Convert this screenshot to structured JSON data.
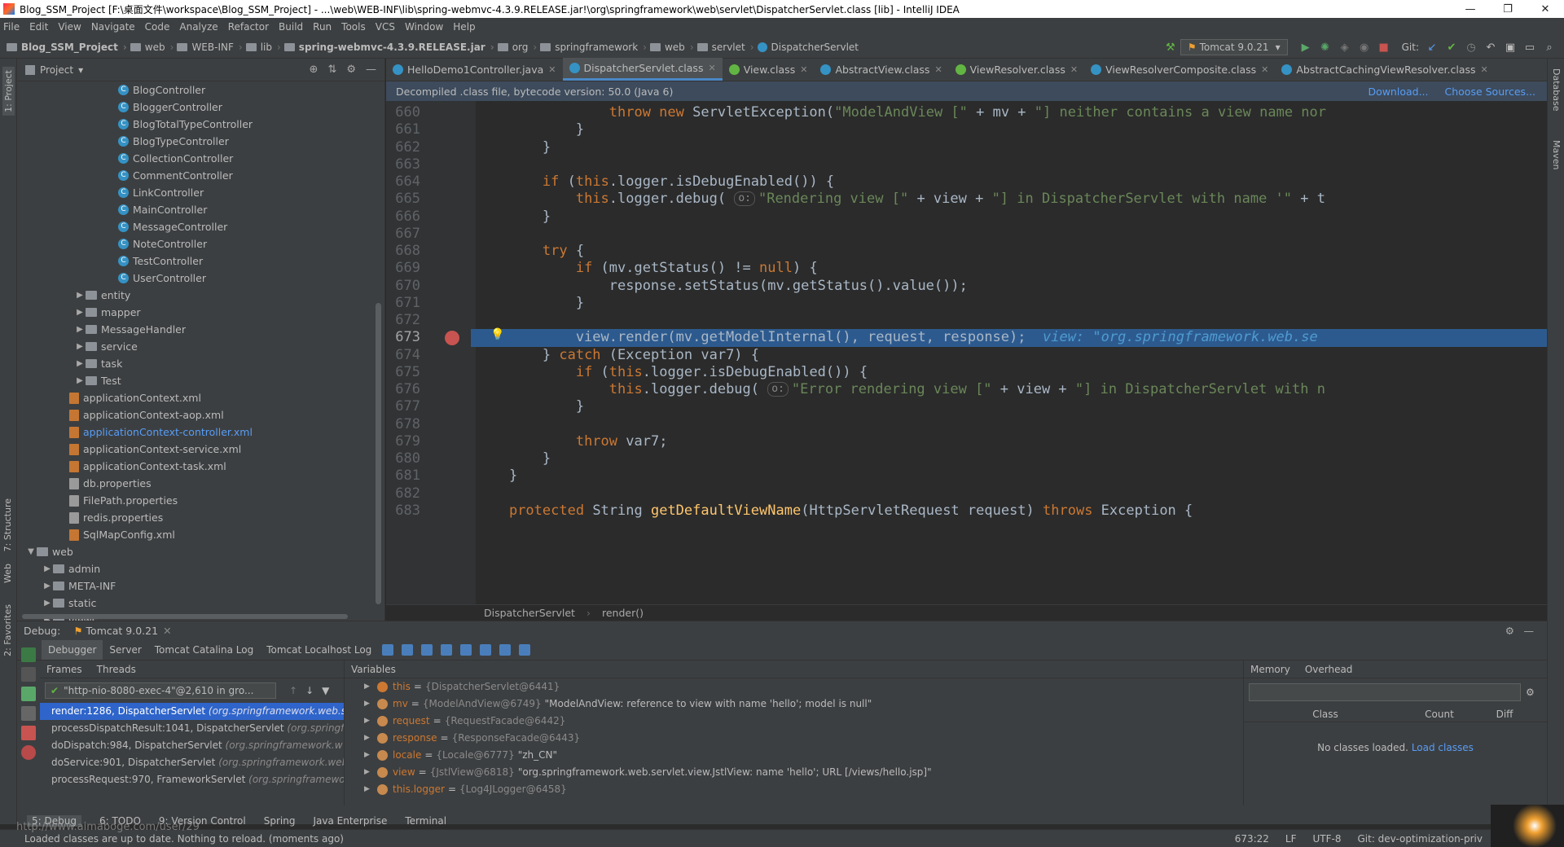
{
  "window": {
    "title": "Blog_SSM_Project [F:\\桌面文件\\workspace\\Blog_SSM_Project] - ...\\web\\WEB-INF\\lib\\spring-webmvc-4.3.9.RELEASE.jar!\\org\\springframework\\web\\servlet\\DispatcherServlet.class [lib] - IntelliJ IDEA",
    "min": "—",
    "max": "❐",
    "close": "✕"
  },
  "menu": [
    "File",
    "Edit",
    "View",
    "Navigate",
    "Code",
    "Analyze",
    "Refactor",
    "Build",
    "Run",
    "Tools",
    "VCS",
    "Window",
    "Help"
  ],
  "breadcrumbs": [
    "Blog_SSM_Project",
    "web",
    "WEB-INF",
    "lib",
    "spring-webmvc-4.3.9.RELEASE.jar",
    "org",
    "springframework",
    "web",
    "servlet",
    "DispatcherServlet"
  ],
  "run_config": "Tomcat 9.0.21",
  "git_label": "Git:",
  "project_panel": {
    "title": "Project",
    "tree": [
      {
        "label": "BlogController",
        "type": "class",
        "indent": 6
      },
      {
        "label": "BloggerController",
        "type": "class",
        "indent": 6
      },
      {
        "label": "BlogTotalTypeController",
        "type": "class",
        "indent": 6
      },
      {
        "label": "BlogTypeController",
        "type": "class",
        "indent": 6
      },
      {
        "label": "CollectionController",
        "type": "class",
        "indent": 6
      },
      {
        "label": "CommentController",
        "type": "class",
        "indent": 6
      },
      {
        "label": "LinkController",
        "type": "class",
        "indent": 6
      },
      {
        "label": "MainController",
        "type": "class",
        "indent": 6
      },
      {
        "label": "MessageController",
        "type": "class",
        "indent": 6
      },
      {
        "label": "NoteController",
        "type": "class",
        "indent": 6
      },
      {
        "label": "TestController",
        "type": "class",
        "indent": 6
      },
      {
        "label": "UserController",
        "type": "class",
        "indent": 6
      },
      {
        "label": "entity",
        "type": "folder",
        "indent": 4,
        "arrow": "▶"
      },
      {
        "label": "mapper",
        "type": "folder",
        "indent": 4,
        "arrow": "▶"
      },
      {
        "label": "MessageHandler",
        "type": "folder",
        "indent": 4,
        "arrow": "▶"
      },
      {
        "label": "service",
        "type": "folder",
        "indent": 4,
        "arrow": "▶"
      },
      {
        "label": "task",
        "type": "folder",
        "indent": 4,
        "arrow": "▶"
      },
      {
        "label": "Test",
        "type": "folder",
        "indent": 4,
        "arrow": "▶"
      },
      {
        "label": "applicationContext.xml",
        "type": "xml",
        "indent": 3
      },
      {
        "label": "applicationContext-aop.xml",
        "type": "xml",
        "indent": 3
      },
      {
        "label": "applicationContext-controller.xml",
        "type": "xml",
        "indent": 3,
        "blue": true
      },
      {
        "label": "applicationContext-service.xml",
        "type": "xml",
        "indent": 3
      },
      {
        "label": "applicationContext-task.xml",
        "type": "xml",
        "indent": 3
      },
      {
        "label": "db.properties",
        "type": "prop",
        "indent": 3
      },
      {
        "label": "FilePath.properties",
        "type": "prop",
        "indent": 3
      },
      {
        "label": "redis.properties",
        "type": "prop",
        "indent": 3
      },
      {
        "label": "SqlMapConfig.xml",
        "type": "xml",
        "indent": 3
      },
      {
        "label": "web",
        "type": "folder",
        "indent": 1,
        "arrow": "▼"
      },
      {
        "label": "admin",
        "type": "folder",
        "indent": 2,
        "arrow": "▶"
      },
      {
        "label": "META-INF",
        "type": "folder",
        "indent": 2,
        "arrow": "▶"
      },
      {
        "label": "static",
        "type": "folder",
        "indent": 2,
        "arrow": "▶"
      },
      {
        "label": "views",
        "type": "folder",
        "indent": 2,
        "arrow": "▶"
      }
    ]
  },
  "editor": {
    "tabs": [
      {
        "label": "HelloDemo1Controller.java",
        "icon": "class"
      },
      {
        "label": "DispatcherServlet.class",
        "icon": "class",
        "active": true
      },
      {
        "label": "View.class",
        "icon": "interface"
      },
      {
        "label": "AbstractView.class",
        "icon": "class"
      },
      {
        "label": "ViewResolver.class",
        "icon": "interface"
      },
      {
        "label": "ViewResolverComposite.class",
        "icon": "class"
      },
      {
        "label": "AbstractCachingViewResolver.class",
        "icon": "class"
      }
    ],
    "banner": "Decompiled .class file, bytecode version: 50.0 (Java 6)",
    "banner_links": [
      "Download...",
      "Choose Sources..."
    ],
    "lines": [
      {
        "n": "660",
        "html": "                <span class=\"kw\">throw new</span> ServletException(<span class=\"str\">\"ModelAndView [\"</span> + mv + <span class=\"str\">\"] neither contains a view name nor</span>"
      },
      {
        "n": "661",
        "html": "            }"
      },
      {
        "n": "662",
        "html": "        }"
      },
      {
        "n": "663",
        "html": ""
      },
      {
        "n": "664",
        "html": "        <span class=\"kw\">if</span> (<span class=\"kw\">this</span>.logger.isDebugEnabled()) {"
      },
      {
        "n": "665",
        "html": "            <span class=\"kw\">this</span>.logger.debug( <span class=\"pill\">o:</span><span class=\"str\">\"Rendering view [\"</span> + view + <span class=\"str\">\"] in DispatcherServlet with name '\"</span> + t"
      },
      {
        "n": "666",
        "html": "        }"
      },
      {
        "n": "667",
        "html": ""
      },
      {
        "n": "668",
        "html": "        <span class=\"kw\">try</span> {"
      },
      {
        "n": "669",
        "html": "            <span class=\"kw\">if</span> (mv.getStatus() != <span class=\"kw\">null</span>) {"
      },
      {
        "n": "670",
        "html": "                response.setStatus(mv.getStatus().value());"
      },
      {
        "n": "671",
        "html": "            }"
      },
      {
        "n": "672",
        "html": ""
      },
      {
        "n": "673",
        "html": "            view.render(mv.getModelInternal(), request, response);  <span class=\"inl\">view: \"org.springframework.web.se</span>",
        "hl": true
      },
      {
        "n": "674",
        "html": "        } <span class=\"kw\">catch</span> (Exception var7) {"
      },
      {
        "n": "675",
        "html": "            <span class=\"kw\">if</span> (<span class=\"kw\">this</span>.logger.isDebugEnabled()) {"
      },
      {
        "n": "676",
        "html": "                <span class=\"kw\">this</span>.logger.debug( <span class=\"pill\">o:</span><span class=\"str\">\"Error rendering view [\"</span> + view + <span class=\"str\">\"] in DispatcherServlet with n</span>"
      },
      {
        "n": "677",
        "html": "            }"
      },
      {
        "n": "678",
        "html": ""
      },
      {
        "n": "679",
        "html": "            <span class=\"kw\">throw</span> var7;"
      },
      {
        "n": "680",
        "html": "        }"
      },
      {
        "n": "681",
        "html": "    }"
      },
      {
        "n": "682",
        "html": ""
      },
      {
        "n": "683",
        "html": "    <span class=\"kw\">protected</span> String <span class=\"fn\">getDefaultViewName</span>(HttpServletRequest request) <span class=\"kw\">throws</span> Exception {"
      }
    ],
    "breadcrumb": [
      "DispatcherServlet",
      "render()"
    ]
  },
  "debug": {
    "label": "Debug:",
    "session": "Tomcat 9.0.21",
    "tabs": [
      "Debugger",
      "Server",
      "Tomcat Catalina Log",
      "Tomcat Localhost Log"
    ],
    "frames_label": "Frames",
    "threads_label": "Threads",
    "thread_selected": "\"http-nio-8080-exec-4\"@2,610 in gro...",
    "frames": [
      {
        "method": "render:1286, DispatcherServlet",
        "pkg": "(org.springframework.web.se"
      },
      {
        "method": "processDispatchResult:1041, DispatcherServlet",
        "pkg": "(org.springfra"
      },
      {
        "method": "doDispatch:984, DispatcherServlet",
        "pkg": "(org.springframework.w"
      },
      {
        "method": "doService:901, DispatcherServlet",
        "pkg": "(org.springframework.web."
      },
      {
        "method": "processRequest:970, FrameworkServlet",
        "pkg": "(org.springframework"
      }
    ],
    "variables_label": "Variables",
    "variables": [
      {
        "name": "this",
        "type": "{DispatcherServlet@6441}",
        "value": "",
        "arrow": "▶"
      },
      {
        "name": "mv",
        "type": "{ModelAndView@6749}",
        "value": "\"ModelAndView: reference to view with name 'hello'; model is null\"",
        "arrow": "▶"
      },
      {
        "name": "request",
        "type": "{RequestFacade@6442}",
        "value": "",
        "arrow": "▶"
      },
      {
        "name": "response",
        "type": "{ResponseFacade@6443}",
        "value": "",
        "arrow": "▶"
      },
      {
        "name": "locale",
        "type": "{Locale@6777}",
        "value": "\"zh_CN\"",
        "arrow": "▶"
      },
      {
        "name": "view",
        "type": "{JstlView@6818}",
        "value": "\"org.springframework.web.servlet.view.JstlView: name 'hello'; URL [/views/hello.jsp]\"",
        "arrow": "▶"
      },
      {
        "name": "this.logger",
        "type": "{Log4JLogger@6458}",
        "value": "",
        "arrow": "▶"
      }
    ],
    "memory_label": "Memory",
    "overhead_label": "Overhead",
    "mem_cols": [
      "Class",
      "Count",
      "Diff"
    ],
    "no_classes": "No classes loaded.",
    "load_classes": "Load classes"
  },
  "bottom_tabs": [
    "5: Debug",
    "6: TODO",
    "9: Version Control",
    "Spring",
    "Java Enterprise",
    "Terminal"
  ],
  "status": {
    "message": "Loaded classes are up to date. Nothing to reload. (moments ago)",
    "position": "673:22",
    "line_sep": "LF",
    "encoding": "UTF-8",
    "git_branch": "Git: dev-optimization-priv"
  },
  "watermark": "http://www.aimaboge.com/user/29",
  "stripe": {
    "project": "1: Project",
    "structure": "7: Structure",
    "web": "Web",
    "favorites": "2: Favorites",
    "database": "Database",
    "maven": "Maven"
  }
}
